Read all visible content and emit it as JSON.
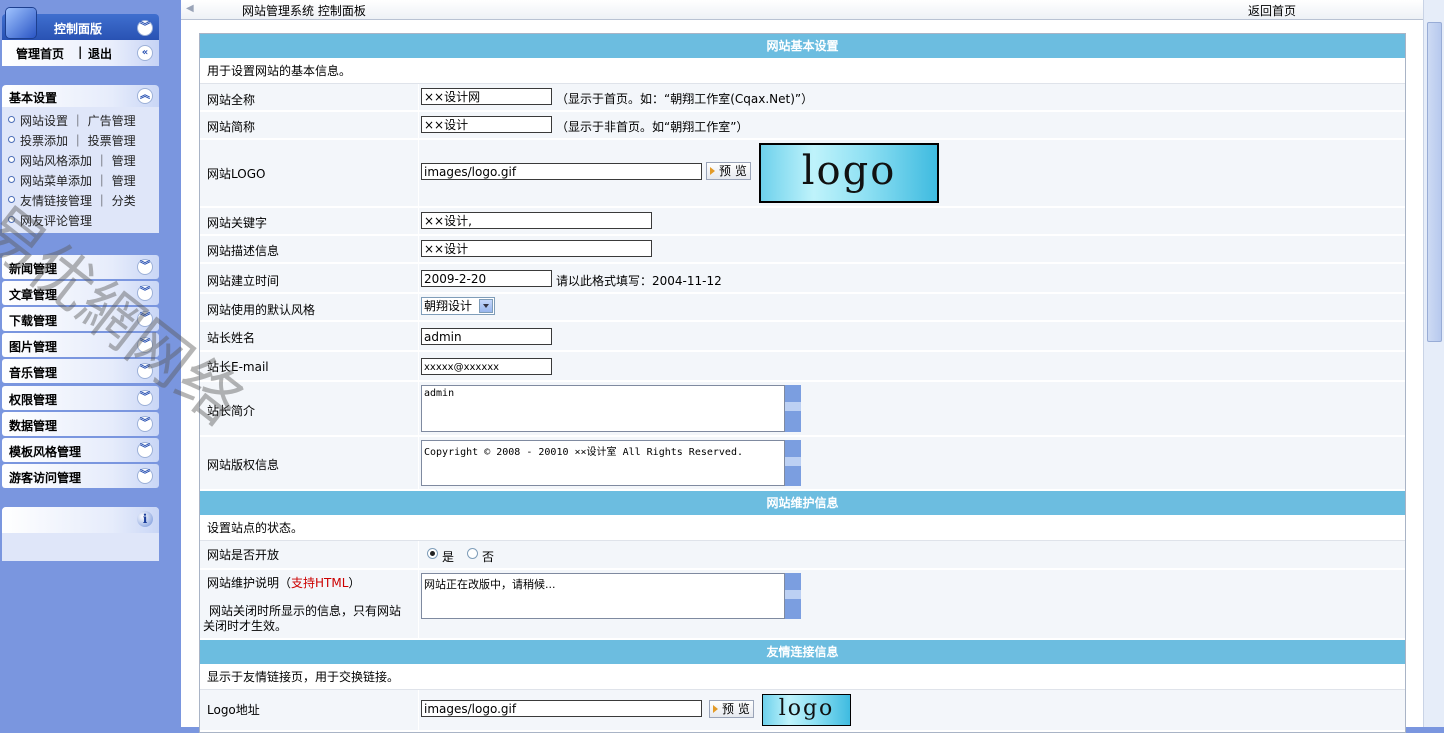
{
  "sidebar": {
    "panel_title": "控制面版",
    "home_link": "管理首页",
    "separator": "|",
    "logout_link": "退出",
    "basic": {
      "title": "基本设置",
      "rows": [
        {
          "a": "网站设置",
          "b": "广告管理"
        },
        {
          "a": "投票添加",
          "b": "投票管理"
        },
        {
          "a": "网站风格添加",
          "b": "管理"
        },
        {
          "a": "网站菜单添加",
          "b": "管理"
        },
        {
          "a": "友情链接管理",
          "b": "分类"
        },
        {
          "a": "网友评论管理",
          "b": ""
        }
      ]
    },
    "menus": [
      "新闻管理",
      "文章管理",
      "下载管理",
      "图片管理",
      "音乐管理",
      "权限管理",
      "数据管理",
      "模板风格管理",
      "游客访问管理"
    ]
  },
  "topbar": {
    "crumb": "网站管理系统  控制面板",
    "home": "返回首页"
  },
  "form": {
    "sec1": {
      "title": "网站基本设置",
      "desc": "用于设置网站的基本信息。",
      "site_name": {
        "label": "网站全称",
        "value": "××设计网",
        "hint": "（显示于首页。如：“朝翔工作室(Cqax.Net)”）"
      },
      "site_short": {
        "label": "网站简称",
        "value": "××设计",
        "hint": "（显示于非首页。如“朝翔工作室”）"
      },
      "site_logo": {
        "label": "网站LOGO",
        "value": "images/logo.gif",
        "button": "预 览",
        "logo_text": "logo"
      },
      "keywords": {
        "label": "网站关键字",
        "value": "××设计,"
      },
      "description": {
        "label": "网站描述信息",
        "value": "××设计"
      },
      "founded": {
        "label": "网站建立时间",
        "value": "2009-2-20",
        "hint": "请以此格式填写：2004-11-12"
      },
      "style": {
        "label": "网站使用的默认风格",
        "value": "朝翔设计"
      },
      "admin_name": {
        "label": "站长姓名",
        "value": "admin"
      },
      "admin_email": {
        "label": "站长E-mail",
        "value": "xxxxx@xxxxxx"
      },
      "admin_intro": {
        "label": "站长简介",
        "value": "admin"
      },
      "copyright": {
        "label": "网站版权信息",
        "value": "Copyright © 2008 - 20010  ××设计室  All Rights Reserved."
      }
    },
    "sec2": {
      "title": "网站维护信息",
      "desc": "设置站点的状态。",
      "open": {
        "label": "网站是否开放",
        "yes": "是",
        "no": "否"
      },
      "maint": {
        "label_pre": "网站维护说明（",
        "label_red": "支持HTML",
        "label_post": "）",
        "note": "网站关闭时所显示的信息，只有网站关闭时才生效。",
        "value": "网站正在改版中，请稍候..."
      }
    },
    "sec3": {
      "title": "友情连接信息",
      "desc": "显示于友情链接页，用于交换链接。",
      "logo_url": {
        "label": "Logo地址",
        "value": "images/logo.gif",
        "button": "预 览",
        "logo_text": "logo"
      }
    }
  },
  "watermark": "易优網网络"
}
